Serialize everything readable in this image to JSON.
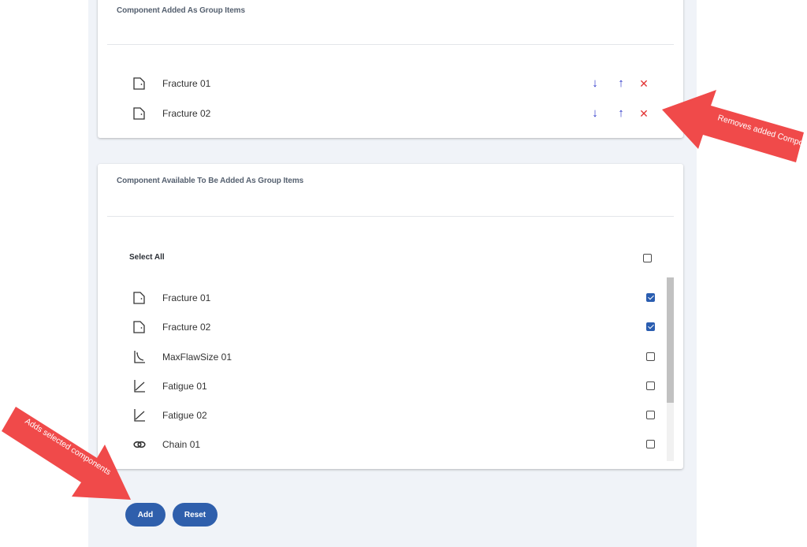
{
  "added_panel": {
    "title": "Component Added As Group Items",
    "items": [
      {
        "name": "Fracture 01",
        "icon": "fracture-icon"
      },
      {
        "name": "Fracture 02",
        "icon": "fracture-icon"
      }
    ],
    "actions": {
      "move_down": "↓",
      "move_up": "↑",
      "remove": "✕"
    }
  },
  "available_panel": {
    "title": "Component Available To Be Added As Group Items",
    "select_all": {
      "label": "Select All",
      "checked": false
    },
    "items": [
      {
        "name": "Fracture 01",
        "icon": "fracture-icon",
        "checked": true
      },
      {
        "name": "Fracture 02",
        "icon": "fracture-icon",
        "checked": true
      },
      {
        "name": "MaxFlawSize 01",
        "icon": "max-flaw-size-icon",
        "checked": false
      },
      {
        "name": "Fatigue 01",
        "icon": "fatigue-icon",
        "checked": false
      },
      {
        "name": "Fatigue 02",
        "icon": "fatigue-icon",
        "checked": false
      },
      {
        "name": "Chain 01",
        "icon": "chain-icon",
        "checked": false
      }
    ]
  },
  "buttons": {
    "add": "Add",
    "reset": "Reset"
  },
  "annotations": {
    "removes": "Removes added Components",
    "adds": "Adds selected components"
  },
  "colors": {
    "accent": "#2f5fac",
    "checkbox_checked": "#2a5db0",
    "arrow_blue": "#2a35c9",
    "remove_red": "#e23434",
    "annotation_red": "#f04a4a",
    "page_background": "#f0f3f8"
  }
}
